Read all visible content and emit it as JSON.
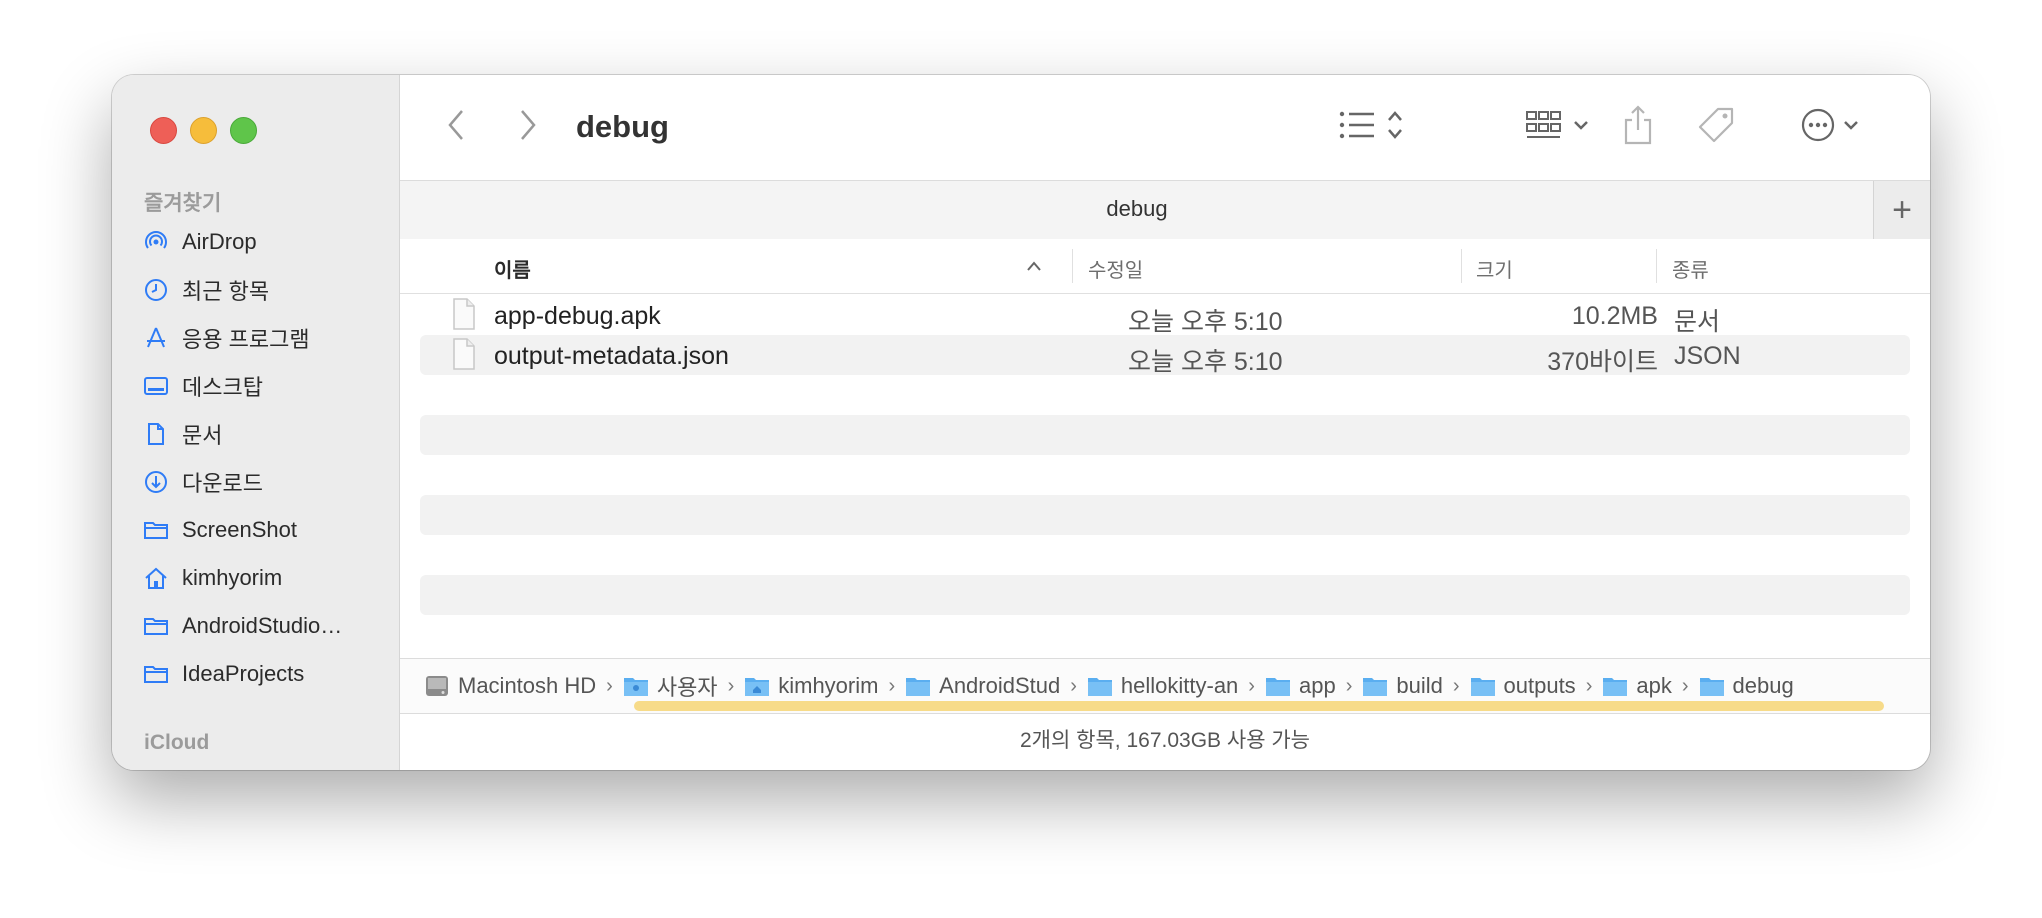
{
  "window": {
    "title": "debug",
    "tab_title": "debug",
    "tab_add": "+"
  },
  "sidebar": {
    "favorites_title": "즐겨찾기",
    "items": [
      {
        "label": "AirDrop",
        "icon": "airdrop-icon"
      },
      {
        "label": "최근 항목",
        "icon": "clock-icon"
      },
      {
        "label": "응용 프로그램",
        "icon": "applications-icon"
      },
      {
        "label": "데스크탑",
        "icon": "desktop-icon"
      },
      {
        "label": "문서",
        "icon": "document-icon"
      },
      {
        "label": "다운로드",
        "icon": "download-icon"
      },
      {
        "label": "ScreenShot",
        "icon": "folder-icon"
      },
      {
        "label": "kimhyorim",
        "icon": "home-icon"
      },
      {
        "label": "AndroidStudio…",
        "icon": "folder-icon"
      },
      {
        "label": "IdeaProjects",
        "icon": "folder-icon"
      }
    ],
    "icloud_title": "iCloud"
  },
  "columns": {
    "name": "이름",
    "date": "수정일",
    "size": "크기",
    "kind": "종류"
  },
  "files": [
    {
      "name": "app-debug.apk",
      "date": "오늘 오후 5:10",
      "size": "10.2MB",
      "kind": "문서"
    },
    {
      "name": "output-metadata.json",
      "date": "오늘 오후 5:10",
      "size": "370바이트",
      "kind": "JSON"
    }
  ],
  "path": [
    {
      "label": "Macintosh HD",
      "icon": "hard-drive-icon"
    },
    {
      "label": "사용자",
      "icon": "users-folder-icon"
    },
    {
      "label": "kimhyorim",
      "icon": "home-folder-icon"
    },
    {
      "label": "AndroidStud",
      "icon": "folder-icon"
    },
    {
      "label": "hellokitty-an",
      "icon": "folder-icon"
    },
    {
      "label": "app",
      "icon": "folder-icon"
    },
    {
      "label": "build",
      "icon": "folder-icon"
    },
    {
      "label": "outputs",
      "icon": "folder-icon"
    },
    {
      "label": "apk",
      "icon": "folder-icon"
    },
    {
      "label": "debug",
      "icon": "folder-icon"
    }
  ],
  "status": "2개의 항목, 167.03GB 사용 가능",
  "colors": {
    "accent": "#2f7cf6",
    "folder": "#5aaef0",
    "highlight": "#f6d77c"
  }
}
